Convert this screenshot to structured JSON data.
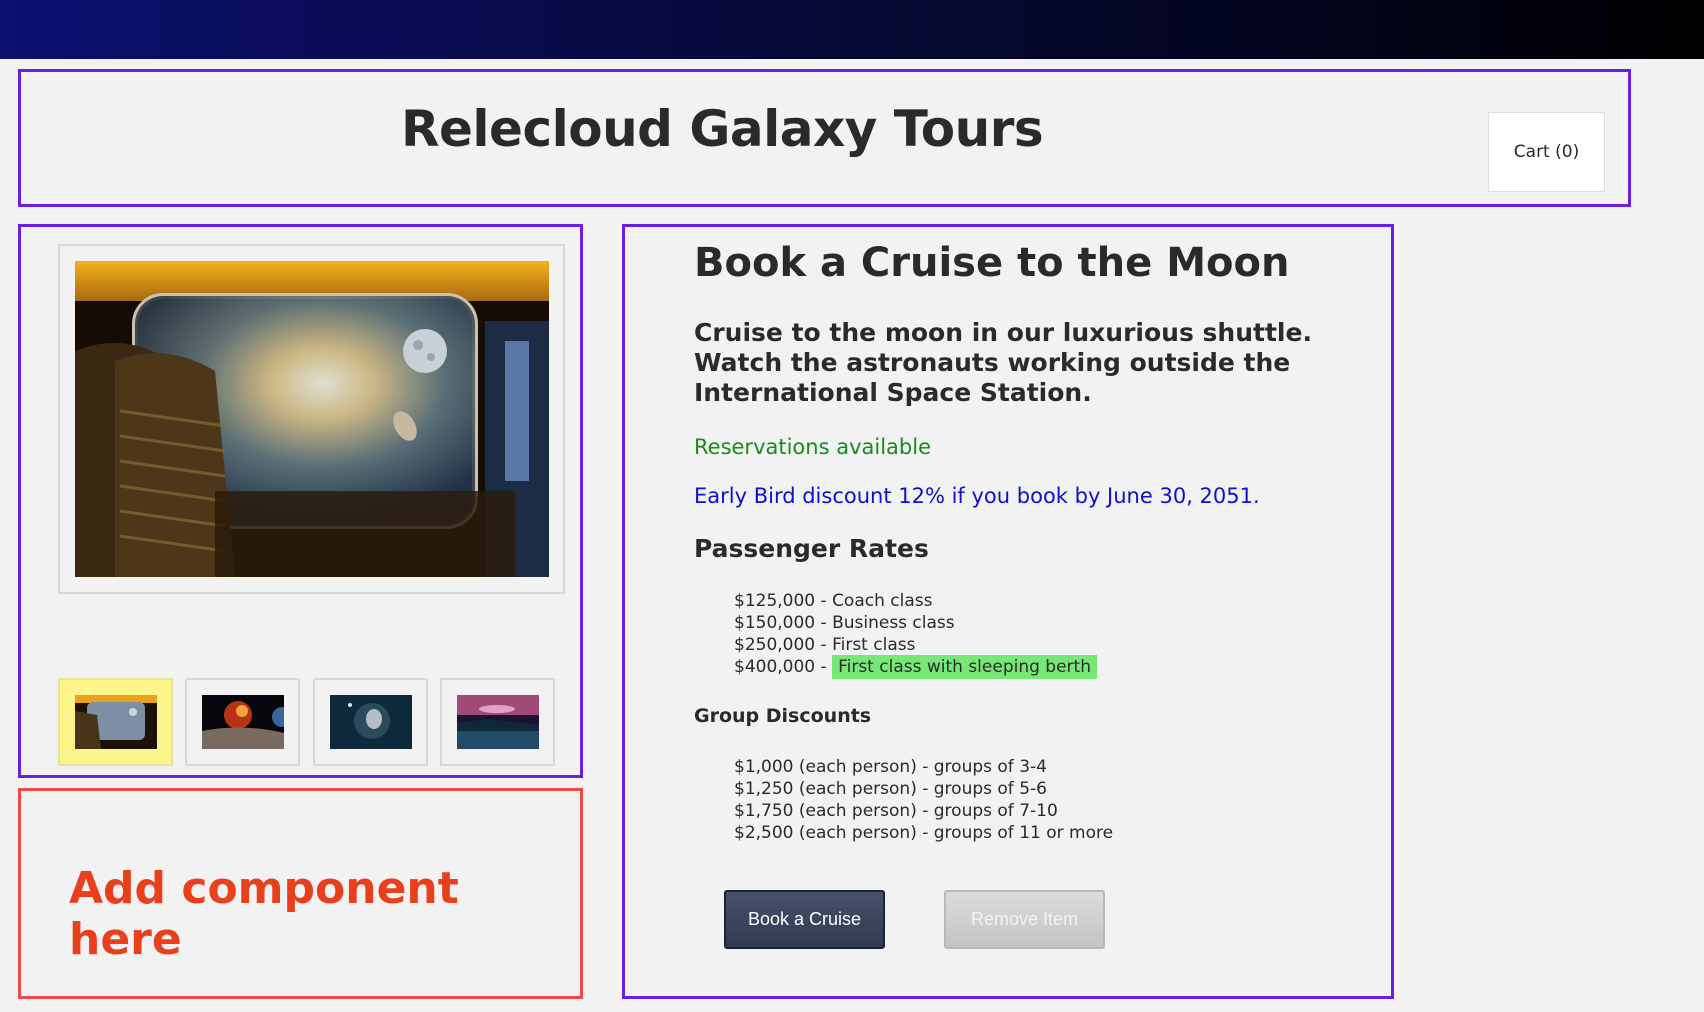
{
  "header": {
    "title": "Relecloud Galaxy Tours",
    "cart_label": "Cart (0)"
  },
  "gallery": {
    "main_image": "spaceship-cabin-window-moon-astronaut",
    "thumbnails": [
      {
        "image": "spaceship-cabin-window",
        "selected": true
      },
      {
        "image": "planet-surface-eruption",
        "selected": false
      },
      {
        "image": "astronaut-spacewalk",
        "selected": false
      },
      {
        "image": "alien-landscape-lake",
        "selected": false
      }
    ],
    "selected_color": "#fbf58a"
  },
  "placeholder": {
    "text": "Add component here",
    "color": "#e8401c"
  },
  "product": {
    "title": "Book a Cruise to the Moon",
    "description": "Cruise to the moon in our luxurious shuttle. Watch the astronauts working outside the International Space Station.",
    "availability": "Reservations available",
    "availability_color": "#1b8a1b",
    "discount": "Early Bird discount 12% if you book by June 30, 2051.",
    "discount_color": "#1010c8",
    "rates_heading": "Passenger Rates",
    "rates": [
      {
        "price": "$125,000 - ",
        "label": "Coach class"
      },
      {
        "price": "$150,000 - ",
        "label": "Business class"
      },
      {
        "price": "$250,000 - ",
        "label": "First class"
      },
      {
        "price": "$400,000 - ",
        "label": "First class with sleeping berth",
        "highlight": true
      }
    ],
    "group_heading": "Group Discounts",
    "group_discounts": [
      "$1,000 (each person) - groups of 3-4",
      "$1,250 (each person) - groups of 5-6",
      "$1,750 (each person) - groups of 7-10",
      "$2,500 (each person) - groups of 11 or more"
    ],
    "book_button": "Book a Cruise",
    "remove_button": "Remove Item"
  },
  "colors": {
    "border_accent": "#6a1fe6",
    "placeholder_border": "#f04a4a",
    "highlight": "#76e876"
  }
}
